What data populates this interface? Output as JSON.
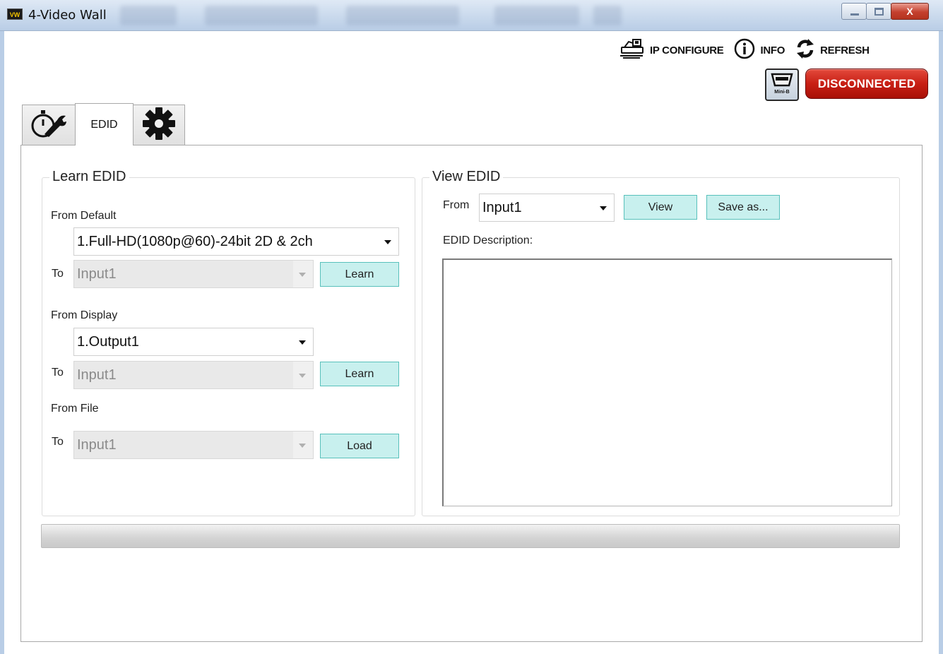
{
  "window": {
    "logo_text": "VW",
    "title": "4-Video Wall",
    "close_glyph": "X"
  },
  "toolbar": {
    "ip_configure": "IP CONFIGURE",
    "info": "INFO",
    "refresh": "REFRESH",
    "usb_label": "Mini-B",
    "status": "DISCONNECTED"
  },
  "tabs": {
    "edid": "EDID"
  },
  "learn_edid": {
    "title": "Learn EDID",
    "from_default_label": "From Default",
    "default_value": "1.Full-HD(1080p@60)-24bit 2D & 2ch",
    "to_label": "To",
    "to_default_value": "Input1",
    "learn_label": "Learn",
    "from_display_label": "From Display",
    "display_value": "1.Output1",
    "to_display_value": "Input1",
    "from_file_label": "From File",
    "to_file_value": "Input1",
    "load_label": "Load"
  },
  "view_edid": {
    "title": "View EDID",
    "from_label": "From",
    "from_value": "Input1",
    "view_label": "View",
    "save_label": "Save as...",
    "description_label": "EDID Description:"
  },
  "progress": {
    "fraction": 0
  },
  "colors": {
    "status_red": "#c81f14",
    "button_teal": "#c8f0ee",
    "button_border": "#58c0bb",
    "titlebar_blue": "#cddcee"
  },
  "icons": {
    "ip_configure": "network-router-icon",
    "info": "info-circle-icon",
    "refresh": "refresh-arrows-icon",
    "usb": "usb-mini-b-icon",
    "tab1": "stopwatch-wrench-icon",
    "tab3": "gear-icon"
  }
}
